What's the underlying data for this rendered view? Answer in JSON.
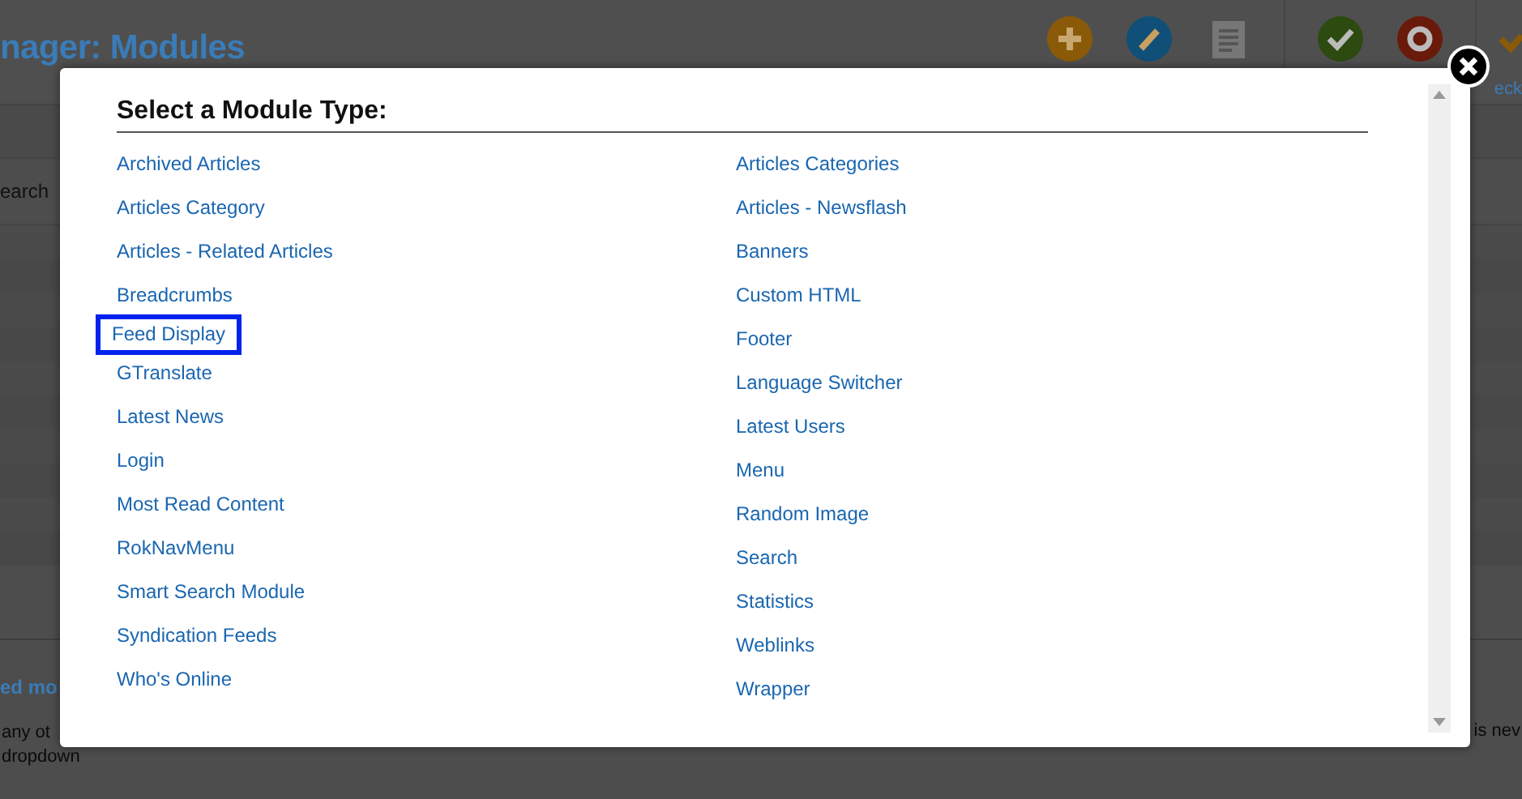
{
  "background_page": {
    "title": "nager: Modules",
    "toolbar_label": "eck",
    "search_label": "earch",
    "section_link": "ed mo",
    "note_left_1": "any ot",
    "note_left_2": "dropdown",
    "note_right": "is nev"
  },
  "modal": {
    "heading": "Select a Module Type:",
    "columns": [
      [
        {
          "label": "Archived Articles",
          "highlighted": false
        },
        {
          "label": "Articles Category",
          "highlighted": false
        },
        {
          "label": "Articles - Related Articles",
          "highlighted": false
        },
        {
          "label": "Breadcrumbs",
          "highlighted": false
        },
        {
          "label": "Feed Display",
          "highlighted": true
        },
        {
          "label": "GTranslate",
          "highlighted": false
        },
        {
          "label": "Latest News",
          "highlighted": false
        },
        {
          "label": "Login",
          "highlighted": false
        },
        {
          "label": "Most Read Content",
          "highlighted": false
        },
        {
          "label": "RokNavMenu",
          "highlighted": false
        },
        {
          "label": "Smart Search Module",
          "highlighted": false
        },
        {
          "label": "Syndication Feeds",
          "highlighted": false
        },
        {
          "label": "Who's Online",
          "highlighted": false
        }
      ],
      [
        {
          "label": "Articles Categories",
          "highlighted": false
        },
        {
          "label": "Articles - Newsflash",
          "highlighted": false
        },
        {
          "label": "Banners",
          "highlighted": false
        },
        {
          "label": "Custom HTML",
          "highlighted": false
        },
        {
          "label": "Footer",
          "highlighted": false
        },
        {
          "label": "Language Switcher",
          "highlighted": false
        },
        {
          "label": "Latest Users",
          "highlighted": false
        },
        {
          "label": "Menu",
          "highlighted": false
        },
        {
          "label": "Random Image",
          "highlighted": false
        },
        {
          "label": "Search",
          "highlighted": false
        },
        {
          "label": "Statistics",
          "highlighted": false
        },
        {
          "label": "Weblinks",
          "highlighted": false
        },
        {
          "label": "Wrapper",
          "highlighted": false
        }
      ]
    ]
  }
}
